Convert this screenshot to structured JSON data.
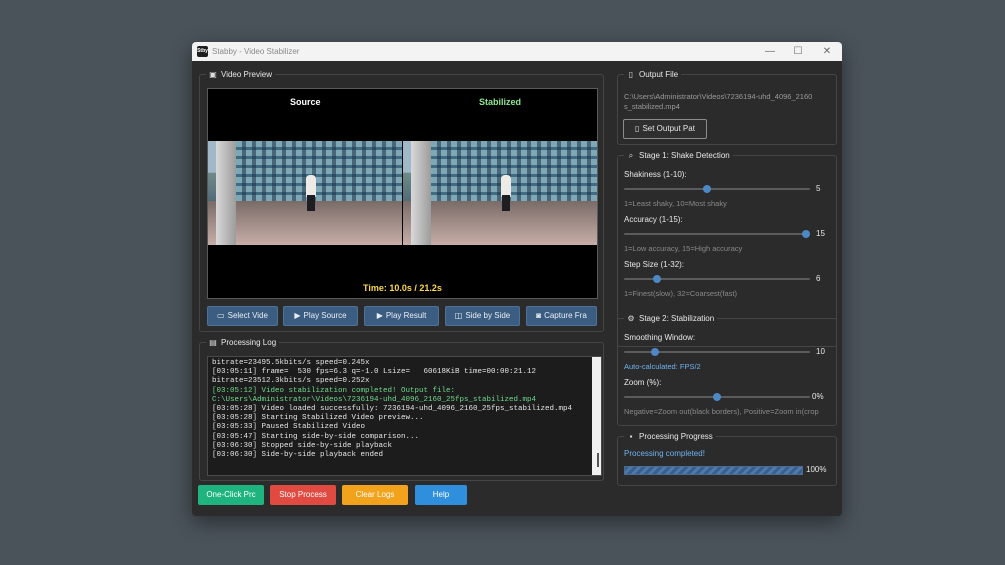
{
  "window": {
    "title": "Stabby - Video Stabilizer",
    "app_icon_text": "Stby",
    "controls": {
      "minimize": "—",
      "maximize": "☐",
      "close": "✕"
    }
  },
  "video_preview": {
    "title": "Video Preview",
    "source_label": "Source",
    "stabilized_label": "Stabilized",
    "time_label": "Time: 10.0s / 21.2s"
  },
  "video_buttons": [
    {
      "label": "Select Vide",
      "icon": "folder-icon"
    },
    {
      "label": "Play Source",
      "icon": "play-icon"
    },
    {
      "label": "Play Result",
      "icon": "play-icon"
    },
    {
      "label": "Side by Side",
      "icon": "split-icon"
    },
    {
      "label": "Capture Fra",
      "icon": "camera-icon"
    }
  ],
  "processing_log": {
    "title": "Processing Log",
    "lines": [
      {
        "text": "bitrate=23495.5kbits/s speed=0.245x",
        "color": "#e6e6e6"
      },
      {
        "text": "[03:05:11] frame=  530 fps=6.3 q=-1.0 Lsize=   60618KiB time=00:00:21.12",
        "color": "#e6e6e6"
      },
      {
        "text": "bitrate=23512.3kbits/s speed=0.252x",
        "color": "#e6e6e6"
      },
      {
        "text": "[03:05:12] Video stabilization completed! Output file:",
        "color": "#6fdc8c"
      },
      {
        "text": "C:\\Users\\Administrator\\Videos\\7236194-uhd_4096_2160_25fps_stabilized.mp4",
        "color": "#6fdc8c"
      },
      {
        "text": "[03:05:28] Video loaded successfully: 7236194-uhd_4096_2160_25fps_stabilized.mp4",
        "color": "#e6e6e6"
      },
      {
        "text": "[03:05:28] Starting Stabilized Video preview...",
        "color": "#e6e6e6"
      },
      {
        "text": "[03:05:33] Paused Stabilized Video",
        "color": "#e6e6e6"
      },
      {
        "text": "[03:05:47] Starting side-by-side comparison...",
        "color": "#e6e6e6"
      },
      {
        "text": "[03:06:30] Stopped side-by-side playback",
        "color": "#e6e6e6"
      },
      {
        "text": "[03:06:30] Side-by-side playback ended",
        "color": "#e6e6e6"
      }
    ]
  },
  "actions": [
    {
      "label": "One-Click Prc",
      "color": "#1fb380"
    },
    {
      "label": "Stop Process",
      "color": "#e04a40"
    },
    {
      "label": "Clear Logs",
      "color": "#f2a31b"
    },
    {
      "label": "Help",
      "color": "#2f8fdc"
    }
  ],
  "output_file": {
    "title": "Output File",
    "path_line1": "C:\\Users\\Administrator\\Videos\\7236194-uhd_4096_2160",
    "path_line2": "s_stabilized.mp4",
    "button": "Set Output Pat"
  },
  "stage1": {
    "title": "Stage 1: Shake Detection",
    "shakiness": {
      "label": "Shakiness (1-10):",
      "value": "5",
      "min": 1,
      "max": 10,
      "hint": "1=Least shaky, 10=Most shaky"
    },
    "accuracy": {
      "label": "Accuracy (1-15):",
      "value": "15",
      "min": 1,
      "max": 15,
      "hint": "1=Low accuracy, 15=High accuracy"
    },
    "step_size": {
      "label": "Step Size (1-32):",
      "value": "6",
      "min": 1,
      "max": 32,
      "hint": "1=Finest(slow), 32=Coarsest(fast)"
    }
  },
  "stage2": {
    "title": "Stage 2: Stabilization",
    "smoothing": {
      "label": "Smoothing Window:",
      "value": "10",
      "fraction": 0.15,
      "hint": "Auto-calculated: FPS/2"
    },
    "zoom": {
      "label": "Zoom (%):",
      "value": "0%",
      "fraction": 0.5,
      "hint": "Negative=Zoom out(black borders), Positive=Zoom in(crop"
    }
  },
  "progress": {
    "title": "Processing Progress",
    "status": "Processing completed!",
    "percent": "100%",
    "fraction": 1.0
  }
}
